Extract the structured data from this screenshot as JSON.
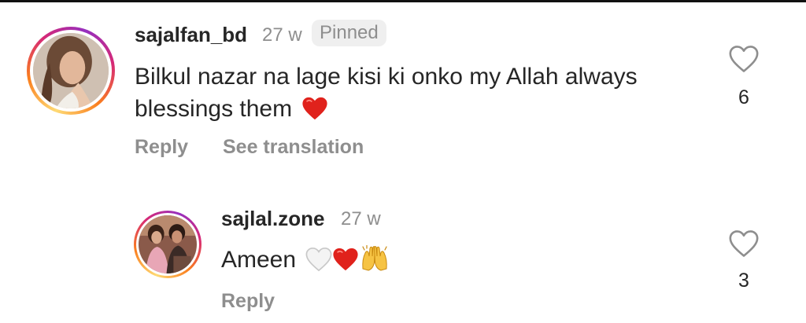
{
  "comments": [
    {
      "username": "sajalfan_bd",
      "time": "27 w",
      "pinned_label": "Pinned",
      "text": "Bilkul nazar na lage kisi ki onko my Allah always blessings them",
      "text_emoji": "red-heart",
      "like_count": "6",
      "reply_label": "Reply",
      "translate_label": "See translation"
    },
    {
      "username": "sajlal.zone",
      "time": "27 w",
      "text": "Ameen",
      "text_emojis": [
        "white-heart",
        "red-heart",
        "raising-hands"
      ],
      "like_count": "3",
      "reply_label": "Reply"
    }
  ],
  "colors": {
    "text_primary": "#262626",
    "text_secondary": "#8e8e8e",
    "pinned_bg": "#efefef",
    "heart_red": "#e0221c",
    "story_ring": [
      "#feda75",
      "#fa7e1e",
      "#d62976",
      "#962fbf"
    ]
  }
}
